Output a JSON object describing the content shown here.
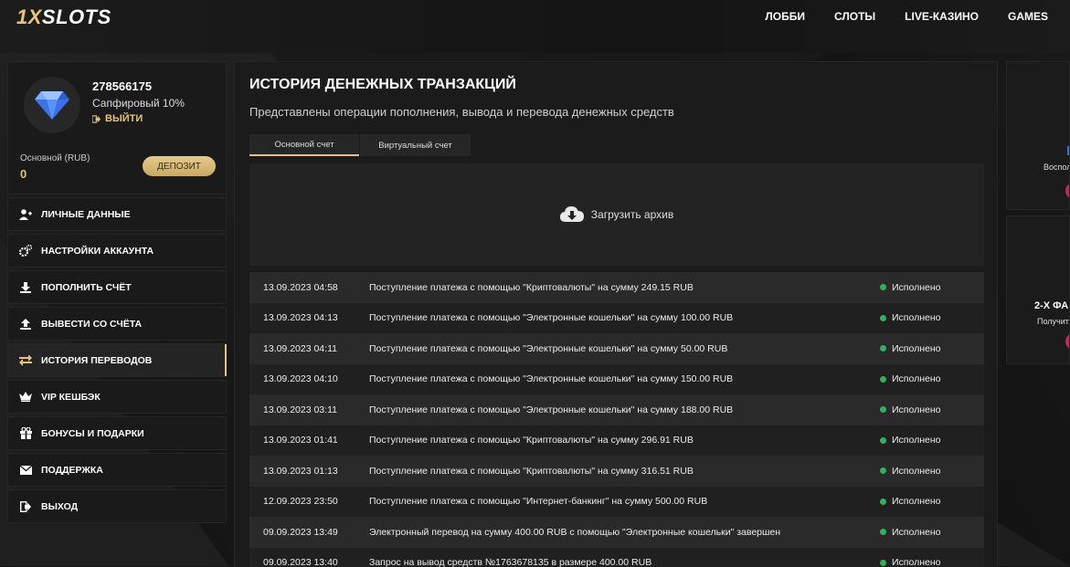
{
  "header": {
    "logo_prefix": "1X",
    "logo_suffix": "SLOTS",
    "nav": [
      "ЛОББИ",
      "СЛОТЫ",
      "LIVE-КАЗИНО",
      "GAMES"
    ]
  },
  "profile": {
    "user_id": "278566175",
    "level": "Сапфировый 10%",
    "logout_label": "ВЫЙТИ",
    "balance_label": "Основной (RUB)",
    "balance_value": "0",
    "deposit_label": "ДЕПОЗИТ"
  },
  "menu": [
    {
      "label": "ЛИЧНЫЕ ДАННЫЕ",
      "icon": "user-plus-icon"
    },
    {
      "label": "НАСТРОЙКИ АККАУНТА",
      "icon": "gears-icon"
    },
    {
      "label": "ПОПОЛНИТЬ СЧЁТ",
      "icon": "download-icon"
    },
    {
      "label": "ВЫВЕСТИ СО СЧЁТА",
      "icon": "upload-icon"
    },
    {
      "label": "ИСТОРИЯ ПЕРЕВОДОВ",
      "icon": "exchange-icon",
      "active": true
    },
    {
      "label": "VIP КЕШБЭК",
      "icon": "crown-icon"
    },
    {
      "label": "БОНУСЫ И ПОДАРКИ",
      "icon": "gift-icon"
    },
    {
      "label": "ПОДДЕРЖКА",
      "icon": "envelope-icon"
    },
    {
      "label": "ВЫХОД",
      "icon": "sign-out-icon"
    }
  ],
  "main": {
    "title": "ИСТОРИЯ ДЕНЕЖНЫХ ТРАНЗАКЦИЙ",
    "subtitle": "Представлены операции пополнения, вывода и перевода денежных средств",
    "tabs": [
      "Основной счет",
      "Виртуальный счет"
    ],
    "archive_label": "Загрузить архив"
  },
  "transactions": [
    {
      "date": "13.09.2023 04:58",
      "desc": "Поступление платежа с помощью \"Криптовалюты\" на сумму 249.15 RUB",
      "status": "Исполнено"
    },
    {
      "date": "13.09.2023 04:13",
      "desc": "Поступление платежа с помощью \"Электронные кошельки\" на сумму 100.00 RUB",
      "status": "Исполнено"
    },
    {
      "date": "13.09.2023 04:11",
      "desc": "Поступление платежа с помощью \"Электронные кошельки\" на сумму 50.00 RUB",
      "status": "Исполнено"
    },
    {
      "date": "13.09.2023 04:10",
      "desc": "Поступление платежа с помощью \"Электронные кошельки\" на сумму 150.00 RUB",
      "status": "Исполнено"
    },
    {
      "date": "13.09.2023 03:11",
      "desc": "Поступление платежа с помощью \"Электронные кошельки\" на сумму 188.00 RUB",
      "status": "Исполнено"
    },
    {
      "date": "13.09.2023 01:41",
      "desc": "Поступление платежа с помощью \"Криптовалюты\" на сумму 296.91 RUB",
      "status": "Исполнено"
    },
    {
      "date": "13.09.2023 01:13",
      "desc": "Поступление платежа с помощью \"Криптовалюты\" на сумму 316.51 RUB",
      "status": "Исполнено"
    },
    {
      "date": "12.09.2023 23:50",
      "desc": "Поступление платежа с помощью \"Интернет-банкинг\" на сумму 500.00 RUB",
      "status": "Исполнено"
    },
    {
      "date": "09.09.2023 13:49",
      "desc": "Электронный перевод на сумму 400.00 RUB с помощью \"Электронные кошельки\" завершен",
      "status": "Исполнено"
    },
    {
      "date": "09.09.2023 13:40",
      "desc": "Запрос на вывод средств №1763678135 в размере 400.00 RUB",
      "status": "Исполнено"
    }
  ],
  "right": {
    "promo1_text": "Воспол",
    "promo2_title": "2-Х ФА",
    "promo2_text": "Получит"
  },
  "colors": {
    "accent": "#e2c27c",
    "status_ok": "#2db35d",
    "promo_pink": "#c3265a"
  }
}
